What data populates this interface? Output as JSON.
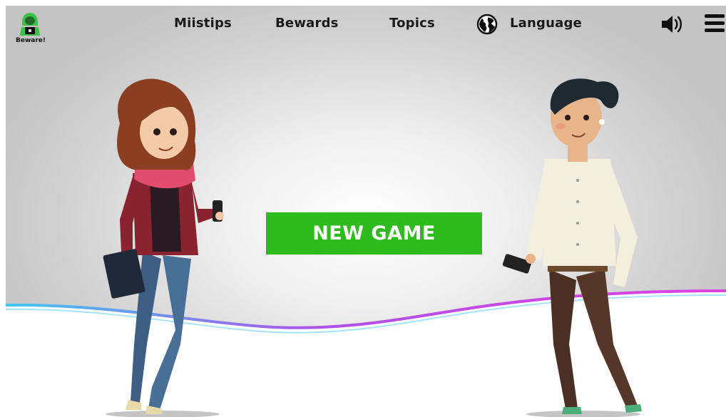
{
  "app": {
    "logo_label": "Beware!"
  },
  "nav": {
    "items": [
      {
        "label": "Miistips"
      },
      {
        "label": "Bewards"
      },
      {
        "label": "Topics"
      },
      {
        "label": "Language"
      }
    ]
  },
  "icons": {
    "language": "globe-icon",
    "sound": "speaker-icon",
    "menu": "hamburger-menu-icon"
  },
  "main": {
    "new_game_label": "NEW GAME"
  },
  "colors": {
    "accent_green": "#2dbb1d",
    "wave_pink": "#e040e0",
    "wave_cyan": "#40c8f0",
    "logo_green": "#3cc04a"
  }
}
